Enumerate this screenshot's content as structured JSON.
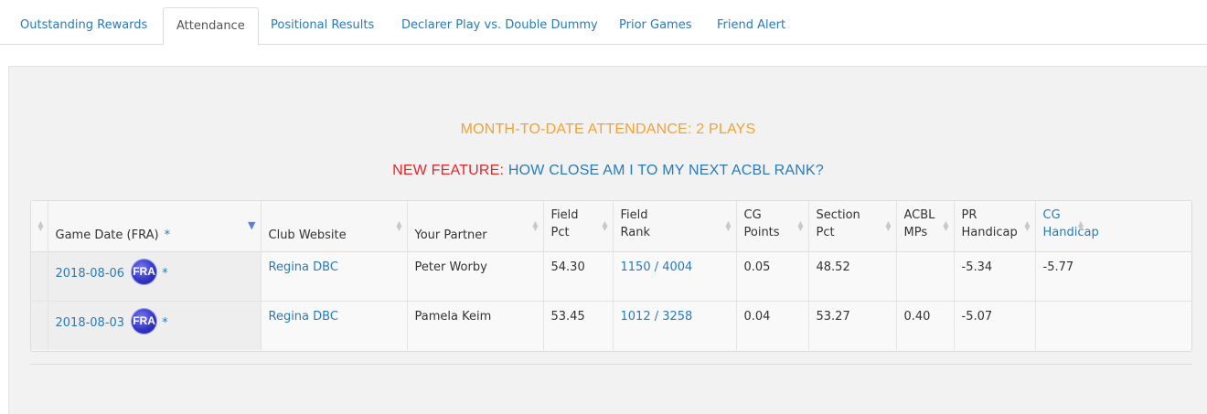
{
  "tabs": [
    {
      "label": "Outstanding Rewards",
      "active": false
    },
    {
      "label": "Attendance",
      "active": true
    },
    {
      "label": "Positional Results",
      "active": false
    },
    {
      "label": "Declarer Play vs. Double Dummy",
      "active": false
    },
    {
      "label": "Prior Games",
      "active": false
    },
    {
      "label": "Friend Alert",
      "active": false
    }
  ],
  "attendance": {
    "month_to_date": "MONTH-TO-DATE ATTENDANCE: 2 PLAYS",
    "new_feature_label": "NEW FEATURE:",
    "new_feature_link": "HOW CLOSE AM I TO MY NEXT ACBL RANK?"
  },
  "table": {
    "headers": {
      "game_date": "Game Date (FRA)",
      "game_date_star": "*",
      "club_website": "Club Website",
      "your_partner": "Your Partner",
      "field_pct": "Field Pct",
      "field_rank": "Field Rank",
      "cg_points": "CG Points",
      "section_pct": "Section Pct",
      "acbl_mps": "ACBL MPs",
      "pr_handicap": "PR Handicap",
      "cg_handicap": "CG Handicap"
    },
    "rows": [
      {
        "game_date": "2018-08-06",
        "badge": "FRA",
        "star": "*",
        "club_website": "Regina DBC",
        "your_partner": "Peter Worby",
        "field_pct": "54.30",
        "field_rank": "1150 / 4004",
        "cg_points": "0.05",
        "section_pct": "48.52",
        "acbl_mps": "",
        "pr_handicap": "-5.34",
        "cg_handicap": "-5.77"
      },
      {
        "game_date": "2018-08-03",
        "badge": "FRA",
        "star": "*",
        "club_website": "Regina DBC",
        "your_partner": "Pamela Keim",
        "field_pct": "53.45",
        "field_rank": "1012 / 3258",
        "cg_points": "0.04",
        "section_pct": "53.27",
        "acbl_mps": "0.40",
        "pr_handicap": "-5.07",
        "cg_handicap": ""
      }
    ]
  },
  "colors": {
    "accent_link": "#2a7ab8",
    "month_to_date": "#f3a22d",
    "new_feature": "#e3262a",
    "sort_active": "#5a7fd6"
  },
  "icons": {
    "sort_both": "sort-icon",
    "sort_active": "sort-desc-icon",
    "badge": "fra-badge-icon"
  }
}
